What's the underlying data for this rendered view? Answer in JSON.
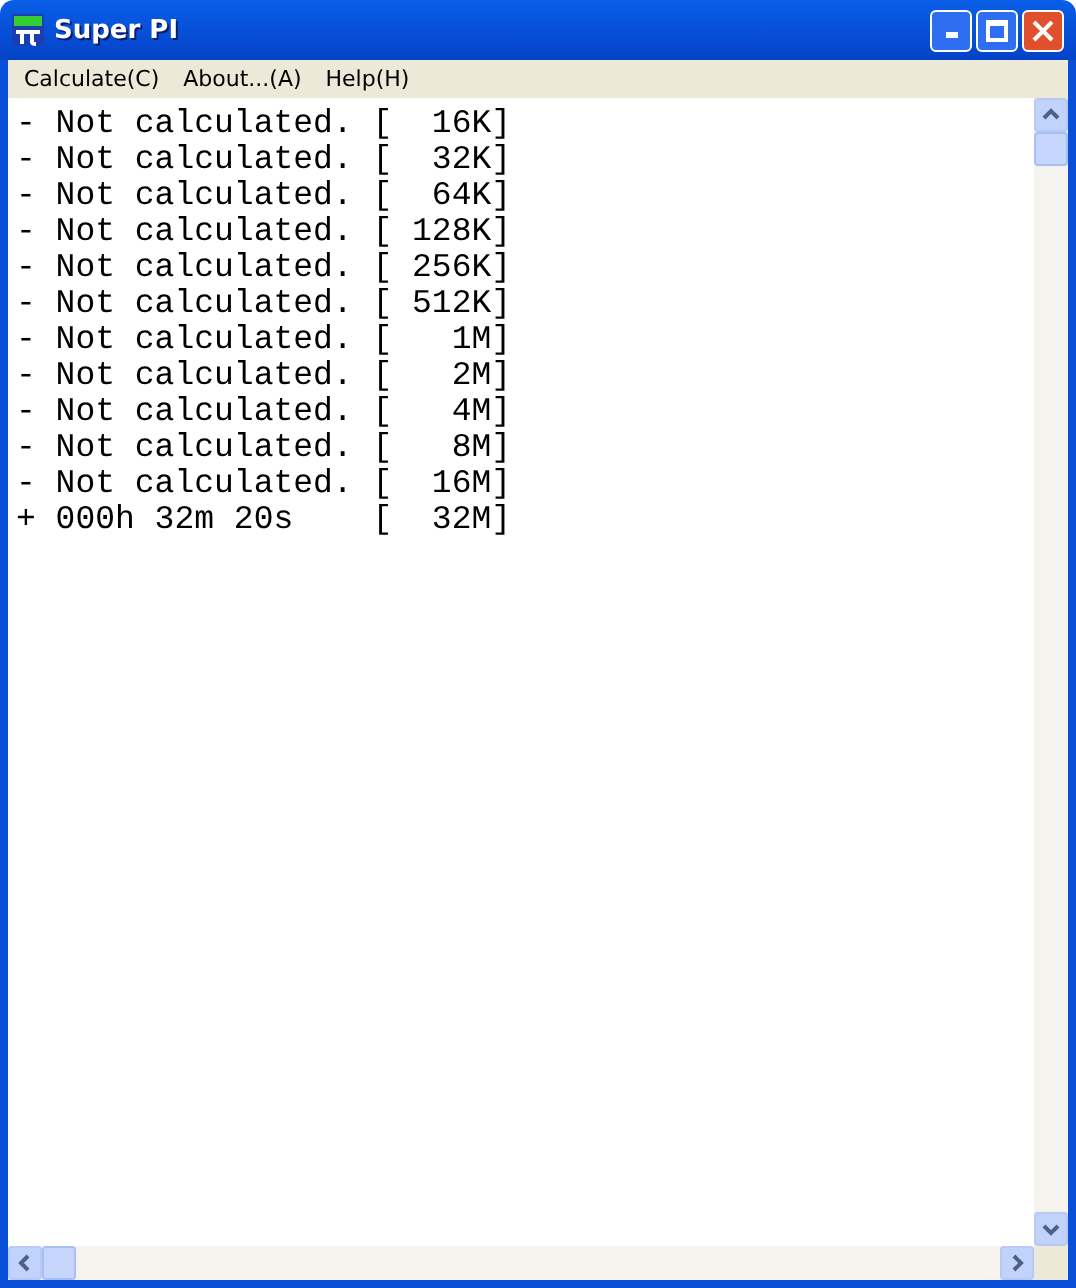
{
  "window": {
    "title": "Super PI"
  },
  "menu": [
    {
      "label": "Calculate(C)"
    },
    {
      "label": "About...(A)"
    },
    {
      "label": "Help(H)"
    }
  ],
  "lines": [
    "- Not calculated. [  16K]",
    "- Not calculated. [  32K]",
    "- Not calculated. [  64K]",
    "- Not calculated. [ 128K]",
    "- Not calculated. [ 256K]",
    "- Not calculated. [ 512K]",
    "- Not calculated. [   1M]",
    "- Not calculated. [   2M]",
    "- Not calculated. [   4M]",
    "- Not calculated. [   8M]",
    "- Not calculated. [  16M]",
    "+ 000h 32m 20s    [  32M]"
  ]
}
